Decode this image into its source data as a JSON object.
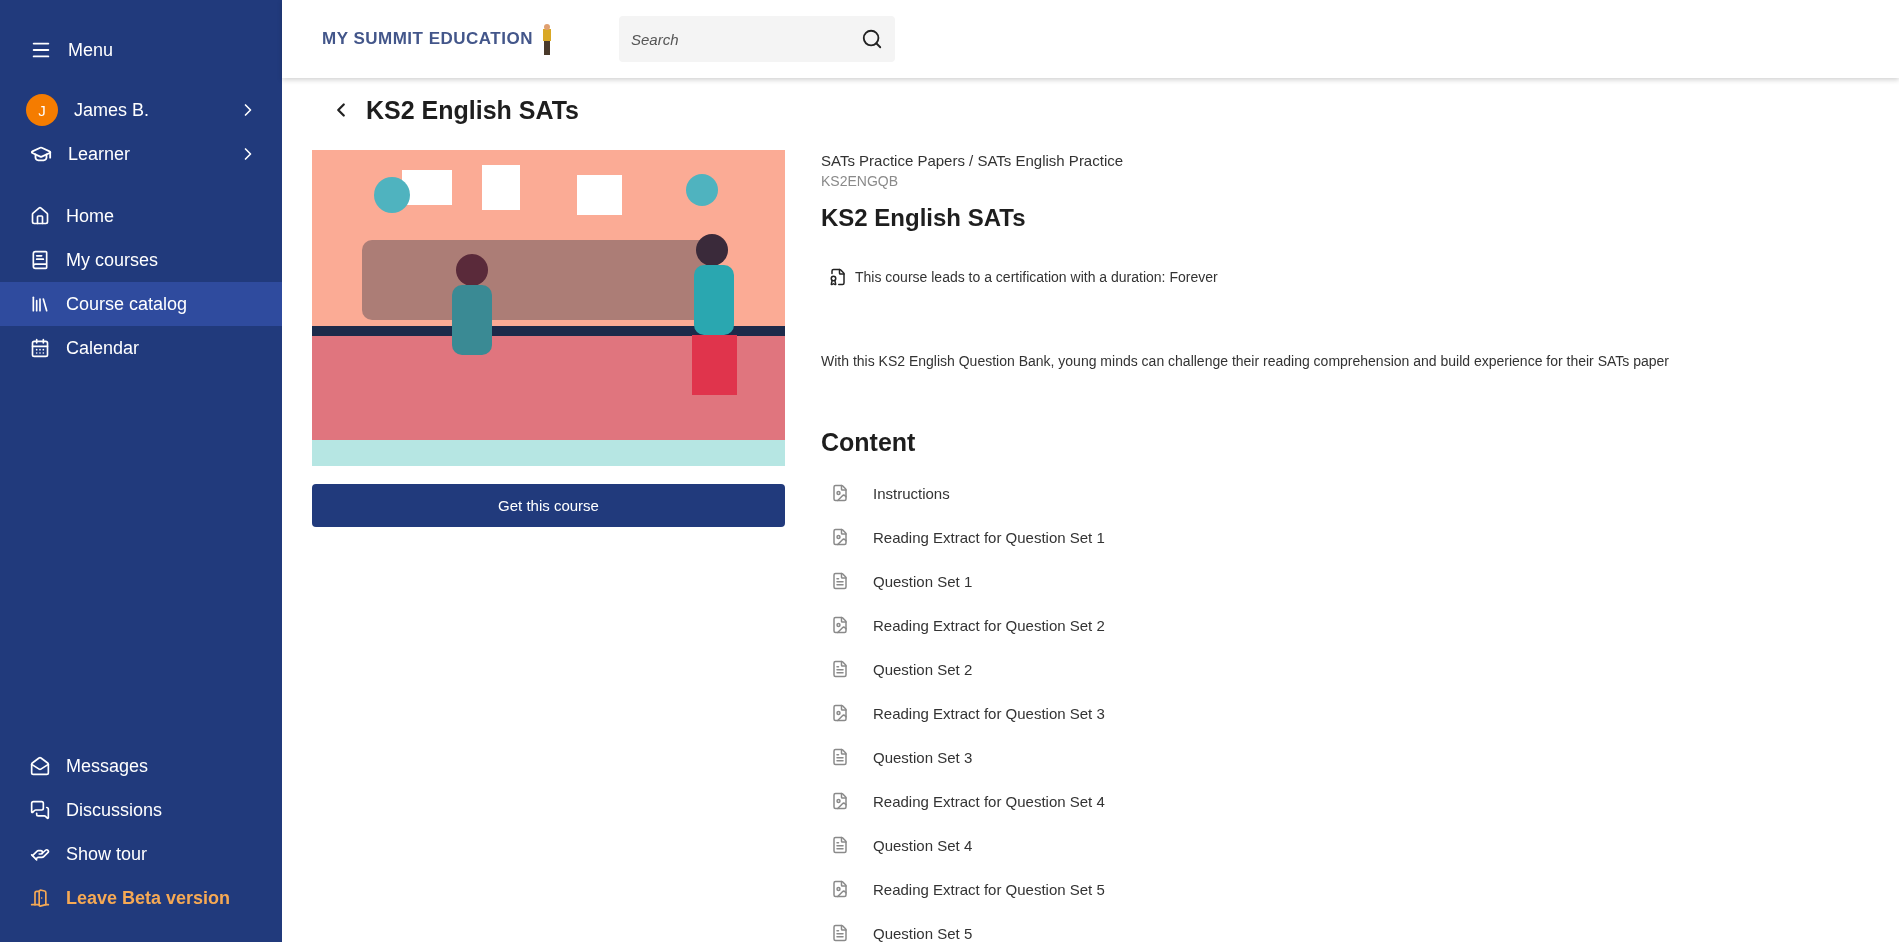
{
  "sidebar": {
    "menu_label": "Menu",
    "user": {
      "initial": "J",
      "name": "James B."
    },
    "role": {
      "label": "Learner"
    },
    "nav": [
      {
        "label": "Home",
        "selected": false
      },
      {
        "label": "My courses",
        "selected": false
      },
      {
        "label": "Course catalog",
        "selected": true
      },
      {
        "label": "Calendar",
        "selected": false
      }
    ],
    "bottom": [
      {
        "label": "Messages",
        "kind": "link"
      },
      {
        "label": "Discussions",
        "kind": "link"
      },
      {
        "label": "Show tour",
        "kind": "link"
      },
      {
        "label": "Leave Beta version",
        "kind": "highlight"
      }
    ]
  },
  "header": {
    "logo": "MY SUMMIT EDUCATION",
    "search": {
      "placeholder": "Search"
    }
  },
  "page": {
    "title": "KS2 English SATs",
    "action": "Get this course",
    "breadcrumb": "SATs Practice Papers / SATs English Practice",
    "code": "KS2ENGQB",
    "course_title": "KS2 English SATs",
    "certification": "This course leads to a certification with a duration: Forever",
    "description": "With this KS2 English Question Bank, young minds can challenge their reading comprehension and build experience for their SATs paper",
    "content_heading": "Content",
    "content": [
      {
        "label": "Instructions",
        "kind": "document"
      },
      {
        "label": "Reading Extract for Question Set 1",
        "kind": "document"
      },
      {
        "label": "Question Set 1",
        "kind": "text"
      },
      {
        "label": "Reading Extract for Question Set 2",
        "kind": "document"
      },
      {
        "label": "Question Set 2",
        "kind": "text"
      },
      {
        "label": "Reading Extract for Question Set 3",
        "kind": "document"
      },
      {
        "label": "Question Set 3",
        "kind": "text"
      },
      {
        "label": "Reading Extract for Question Set 4",
        "kind": "document"
      },
      {
        "label": "Question Set 4",
        "kind": "text"
      },
      {
        "label": "Reading Extract for Question Set 5",
        "kind": "document"
      },
      {
        "label": "Question Set 5",
        "kind": "text"
      }
    ]
  }
}
